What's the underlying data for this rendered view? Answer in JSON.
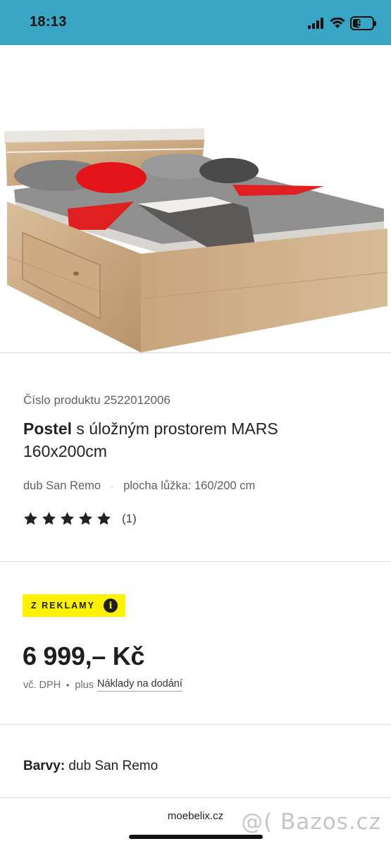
{
  "status_bar": {
    "time": "18:13",
    "battery": "50",
    "battery_level": 0.5
  },
  "product": {
    "id_label": "Číslo produktu 2522012006",
    "title_bold": "Postel",
    "title_rest": " s úložným prostorem MARS 160x200cm",
    "attr_color": "dub San Remo",
    "attr_separator": "·",
    "attr_size": "plocha lůžka: 160/200 cm",
    "rating_stars": 5,
    "rating_count": "(1)"
  },
  "promo": {
    "badge": "Z REKLAMY",
    "info_icon": "i"
  },
  "pricing": {
    "price": "6 999,– Kč",
    "vat_note": "vč. DPH",
    "separator": "•",
    "plus_label": "plus",
    "shipping_link": "Náklady na dodání"
  },
  "details": {
    "colors_label": "Barvy:",
    "colors_value": " dub San Remo"
  },
  "browser": {
    "url": "moebelix.cz"
  },
  "watermark": "@( Bazos.cz",
  "theme": {
    "status_bar_bg": "#3aa6c6",
    "badge_bg": "#fff200",
    "text": "#222222"
  }
}
